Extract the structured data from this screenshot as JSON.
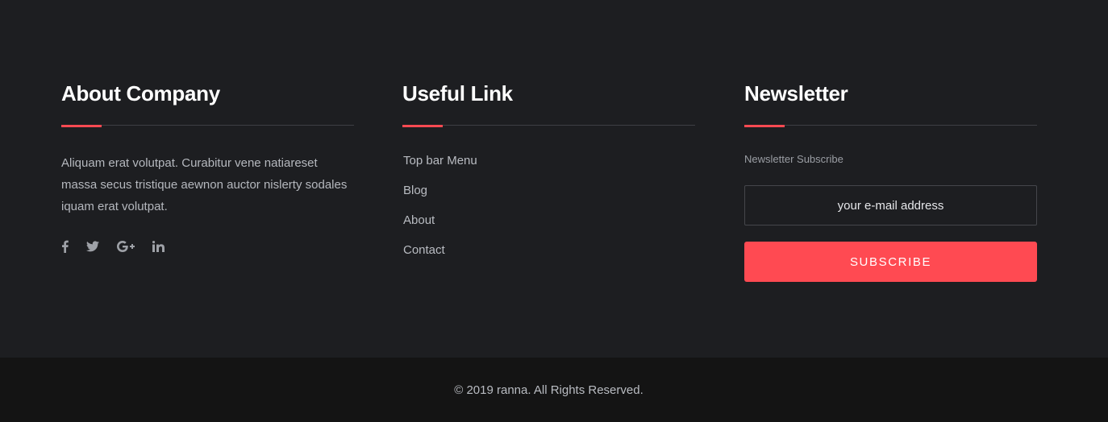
{
  "about": {
    "title": "About Company",
    "text": "Aliquam erat volutpat. Curabitur vene natiareset massa secus tristique aewnon auctor nislerty sodales iquam erat volutpat.",
    "social": [
      {
        "name": "facebook-icon"
      },
      {
        "name": "twitter-icon"
      },
      {
        "name": "google-plus-icon"
      },
      {
        "name": "linkedin-icon"
      }
    ]
  },
  "links": {
    "title": "Useful Link",
    "items": [
      {
        "label": "Top bar Menu"
      },
      {
        "label": "Blog"
      },
      {
        "label": "About"
      },
      {
        "label": "Contact"
      }
    ]
  },
  "newsletter": {
    "title": "Newsletter",
    "label": "Newsletter Subscribe",
    "placeholder": "your e-mail address",
    "button_label": "SUBSCRIBE"
  },
  "footer": {
    "copyright": "© 2019 ranna. All Rights Reserved."
  },
  "colors": {
    "background": "#1d1e21",
    "bottom_bar": "#141414",
    "accent": "#ff4a52",
    "heading": "#ffffff",
    "text": "#b9bcc2"
  }
}
